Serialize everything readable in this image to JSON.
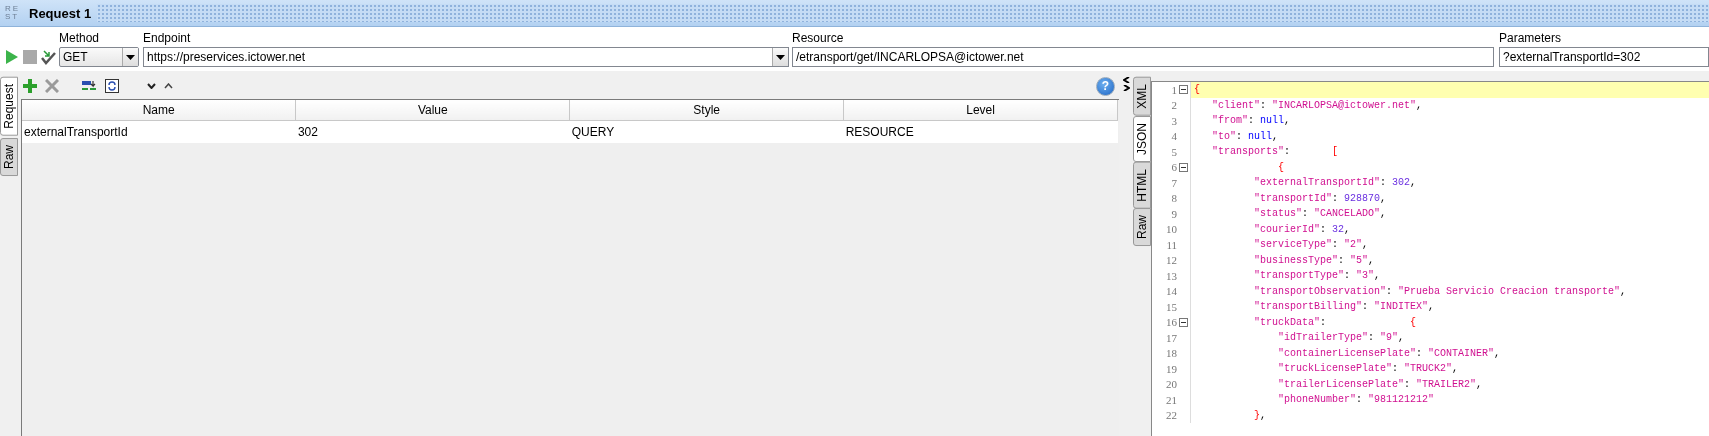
{
  "title_bar": {
    "icon_text": [
      "RE",
      "ST"
    ],
    "title": "Request 1"
  },
  "request_bar": {
    "method": {
      "label": "Method",
      "value": "GET"
    },
    "endpoint": {
      "label": "Endpoint",
      "value": "https://preservices.ictower.net"
    },
    "resource": {
      "label": "Resource",
      "value": "/etransport/get/INCARLOPSA@ictower.net"
    },
    "parameters": {
      "label": "Parameters",
      "value": "?externalTransportId=302"
    }
  },
  "left_tabs": [
    {
      "label": "Request",
      "selected": true
    },
    {
      "label": "Raw",
      "selected": false
    }
  ],
  "help_button": "?",
  "params_table": {
    "columns": [
      "Name",
      "Value",
      "Style",
      "Level"
    ],
    "rows": [
      {
        "cells": [
          "externalTransportId",
          "302",
          "QUERY",
          "RESOURCE"
        ],
        "selected": false
      }
    ]
  },
  "right_tabs": [
    {
      "label": "XML",
      "selected": false
    },
    {
      "label": "JSON",
      "selected": true
    },
    {
      "label": "HTML",
      "selected": false
    },
    {
      "label": "Raw",
      "selected": false
    }
  ],
  "editor_lines": [
    {
      "num": "1",
      "fold": true,
      "current": true,
      "tokens": [
        {
          "kind": "brace",
          "text": "{"
        }
      ]
    },
    {
      "num": "2",
      "fold": false,
      "current": false,
      "tokens": [
        {
          "kind": "key",
          "text": "   \"client\""
        },
        {
          "kind": "punct",
          "text": ": "
        },
        {
          "kind": "str",
          "text": "\"INCARLOPSA@ictower.net\""
        },
        {
          "kind": "punct",
          "text": ","
        }
      ]
    },
    {
      "num": "3",
      "fold": false,
      "current": false,
      "tokens": [
        {
          "kind": "key",
          "text": "   \"from\""
        },
        {
          "kind": "punct",
          "text": ": "
        },
        {
          "kind": "null",
          "text": "null"
        },
        {
          "kind": "punct",
          "text": ","
        }
      ]
    },
    {
      "num": "4",
      "fold": false,
      "current": false,
      "tokens": [
        {
          "kind": "key",
          "text": "   \"to\""
        },
        {
          "kind": "punct",
          "text": ": "
        },
        {
          "kind": "null",
          "text": "null"
        },
        {
          "kind": "punct",
          "text": ","
        }
      ]
    },
    {
      "num": "5",
      "fold": false,
      "current": false,
      "tokens": [
        {
          "kind": "key",
          "text": "   \"transports\""
        },
        {
          "kind": "punct",
          "text": ":       "
        },
        {
          "kind": "brace",
          "text": "["
        }
      ]
    },
    {
      "num": "6",
      "fold": true,
      "current": false,
      "tokens": [
        {
          "kind": "brace",
          "text": "              {"
        }
      ]
    },
    {
      "num": "7",
      "fold": false,
      "current": false,
      "tokens": [
        {
          "kind": "key",
          "text": "          \"externalTransportId\""
        },
        {
          "kind": "punct",
          "text": ": "
        },
        {
          "kind": "num",
          "text": "302"
        },
        {
          "kind": "punct",
          "text": ","
        }
      ]
    },
    {
      "num": "8",
      "fold": false,
      "current": false,
      "tokens": [
        {
          "kind": "key",
          "text": "          \"transportId\""
        },
        {
          "kind": "punct",
          "text": ": "
        },
        {
          "kind": "num",
          "text": "928870"
        },
        {
          "kind": "punct",
          "text": ","
        }
      ]
    },
    {
      "num": "9",
      "fold": false,
      "current": false,
      "tokens": [
        {
          "kind": "key",
          "text": "          \"status\""
        },
        {
          "kind": "punct",
          "text": ": "
        },
        {
          "kind": "str",
          "text": "\"CANCELADO\""
        },
        {
          "kind": "punct",
          "text": ","
        }
      ]
    },
    {
      "num": "10",
      "fold": false,
      "current": false,
      "tokens": [
        {
          "kind": "key",
          "text": "          \"courierId\""
        },
        {
          "kind": "punct",
          "text": ": "
        },
        {
          "kind": "num",
          "text": "32"
        },
        {
          "kind": "punct",
          "text": ","
        }
      ]
    },
    {
      "num": "11",
      "fold": false,
      "current": false,
      "tokens": [
        {
          "kind": "key",
          "text": "          \"serviceType\""
        },
        {
          "kind": "punct",
          "text": ": "
        },
        {
          "kind": "str",
          "text": "\"2\""
        },
        {
          "kind": "punct",
          "text": ","
        }
      ]
    },
    {
      "num": "12",
      "fold": false,
      "current": false,
      "tokens": [
        {
          "kind": "key",
          "text": "          \"businessType\""
        },
        {
          "kind": "punct",
          "text": ": "
        },
        {
          "kind": "str",
          "text": "\"5\""
        },
        {
          "kind": "punct",
          "text": ","
        }
      ]
    },
    {
      "num": "13",
      "fold": false,
      "current": false,
      "tokens": [
        {
          "kind": "key",
          "text": "          \"transportType\""
        },
        {
          "kind": "punct",
          "text": ": "
        },
        {
          "kind": "str",
          "text": "\"3\""
        },
        {
          "kind": "punct",
          "text": ","
        }
      ]
    },
    {
      "num": "14",
      "fold": false,
      "current": false,
      "tokens": [
        {
          "kind": "key",
          "text": "          \"transportObservation\""
        },
        {
          "kind": "punct",
          "text": ": "
        },
        {
          "kind": "str",
          "text": "\"Prueba Servicio Creacion transporte\""
        },
        {
          "kind": "punct",
          "text": ","
        }
      ]
    },
    {
      "num": "15",
      "fold": false,
      "current": false,
      "tokens": [
        {
          "kind": "key",
          "text": "          \"transportBilling\""
        },
        {
          "kind": "punct",
          "text": ": "
        },
        {
          "kind": "str",
          "text": "\"INDITEX\""
        },
        {
          "kind": "punct",
          "text": ","
        }
      ]
    },
    {
      "num": "16",
      "fold": true,
      "current": false,
      "tokens": [
        {
          "kind": "key",
          "text": "          \"truckData\""
        },
        {
          "kind": "punct",
          "text": ":              "
        },
        {
          "kind": "brace",
          "text": "{"
        }
      ]
    },
    {
      "num": "17",
      "fold": false,
      "current": false,
      "tokens": [
        {
          "kind": "key",
          "text": "              \"idTrailerType\""
        },
        {
          "kind": "punct",
          "text": ": "
        },
        {
          "kind": "str",
          "text": "\"9\""
        },
        {
          "kind": "punct",
          "text": ","
        }
      ]
    },
    {
      "num": "18",
      "fold": false,
      "current": false,
      "tokens": [
        {
          "kind": "key",
          "text": "              \"containerLicensePlate\""
        },
        {
          "kind": "punct",
          "text": ": "
        },
        {
          "kind": "str",
          "text": "\"CONTAINER\""
        },
        {
          "kind": "punct",
          "text": ","
        }
      ]
    },
    {
      "num": "19",
      "fold": false,
      "current": false,
      "tokens": [
        {
          "kind": "key",
          "text": "              \"truckLicensePlate\""
        },
        {
          "kind": "punct",
          "text": ": "
        },
        {
          "kind": "str",
          "text": "\"TRUCK2\""
        },
        {
          "kind": "punct",
          "text": ","
        }
      ]
    },
    {
      "num": "20",
      "fold": false,
      "current": false,
      "tokens": [
        {
          "kind": "key",
          "text": "              \"trailerLicensePlate\""
        },
        {
          "kind": "punct",
          "text": ": "
        },
        {
          "kind": "str",
          "text": "\"TRAILER2\""
        },
        {
          "kind": "punct",
          "text": ","
        }
      ]
    },
    {
      "num": "21",
      "fold": false,
      "current": false,
      "tokens": [
        {
          "kind": "key",
          "text": "              \"phoneNumber\""
        },
        {
          "kind": "punct",
          "text": ": "
        },
        {
          "kind": "str",
          "text": "\"981121212\""
        }
      ]
    },
    {
      "num": "22",
      "fold": false,
      "current": false,
      "tokens": [
        {
          "kind": "brace",
          "text": "          }"
        },
        {
          "kind": "punct",
          "text": ","
        }
      ]
    }
  ]
}
